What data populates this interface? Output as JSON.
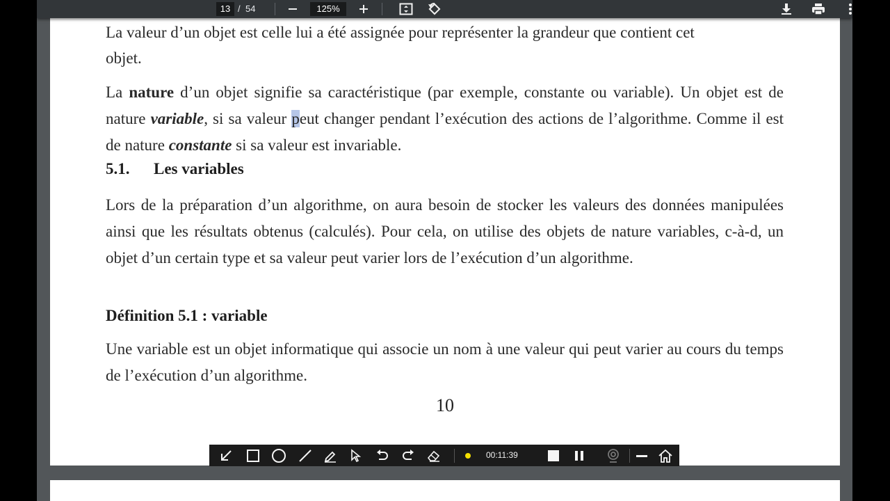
{
  "toolbar": {
    "current_page": "13",
    "page_separator": "/",
    "total_pages": "54",
    "zoom": "125%",
    "icons": [
      "minus-icon",
      "plus-icon",
      "fit-page-icon",
      "rotate-icon",
      "download-icon",
      "print-icon",
      "more-vert-icon"
    ]
  },
  "document": {
    "top_cut_line": "La valeur d’un objet est celle lui a été assignée pour représenter la grandeur que contient cet",
    "para1_end": "objet.",
    "para2": {
      "t1": "La ",
      "b1": "nature",
      "t2": " d’un objet signifie sa caractéristique (par exemple, constante ou variable). Un objet est de nature ",
      "bi1": "variable",
      "t3": ", si sa valeur ",
      "hl": "p",
      "t4": "eut changer pendant l’exécution des actions de l’algorithme. Comme il est de nature ",
      "bi2": "constante",
      "t5": " si sa valeur est invariable."
    },
    "section_number": "5.1.",
    "section_title": "Les variables",
    "para3": "Lors de la préparation d’un algorithme, on aura besoin de stocker les valeurs des données manipulées ainsi que les résultats obtenus (calculés). Pour cela, on utilise des objets de nature variables, c-à-d, un objet d’un certain type et sa valeur peut varier lors de l’exécution d’un algorithme.",
    "definition_heading": "Définition 5.1 : variable",
    "para4": "Une variable est un objet informatique qui associe un nom à une valeur qui peut varier au cours du temps de l’exécution d’un algorithme.",
    "page_number": "10"
  },
  "annotation_bar": {
    "timer": "00:11:39",
    "tools": [
      "arrow-icon",
      "rectangle-icon",
      "circle-icon",
      "line-icon",
      "pen-icon",
      "pointer-icon",
      "undo-icon",
      "redo-icon",
      "eraser-icon",
      "color-dot-icon",
      "stop-icon",
      "pause-icon",
      "webcam-icon",
      "minimize-icon",
      "home-icon"
    ],
    "dot_color": "#f5e000"
  }
}
